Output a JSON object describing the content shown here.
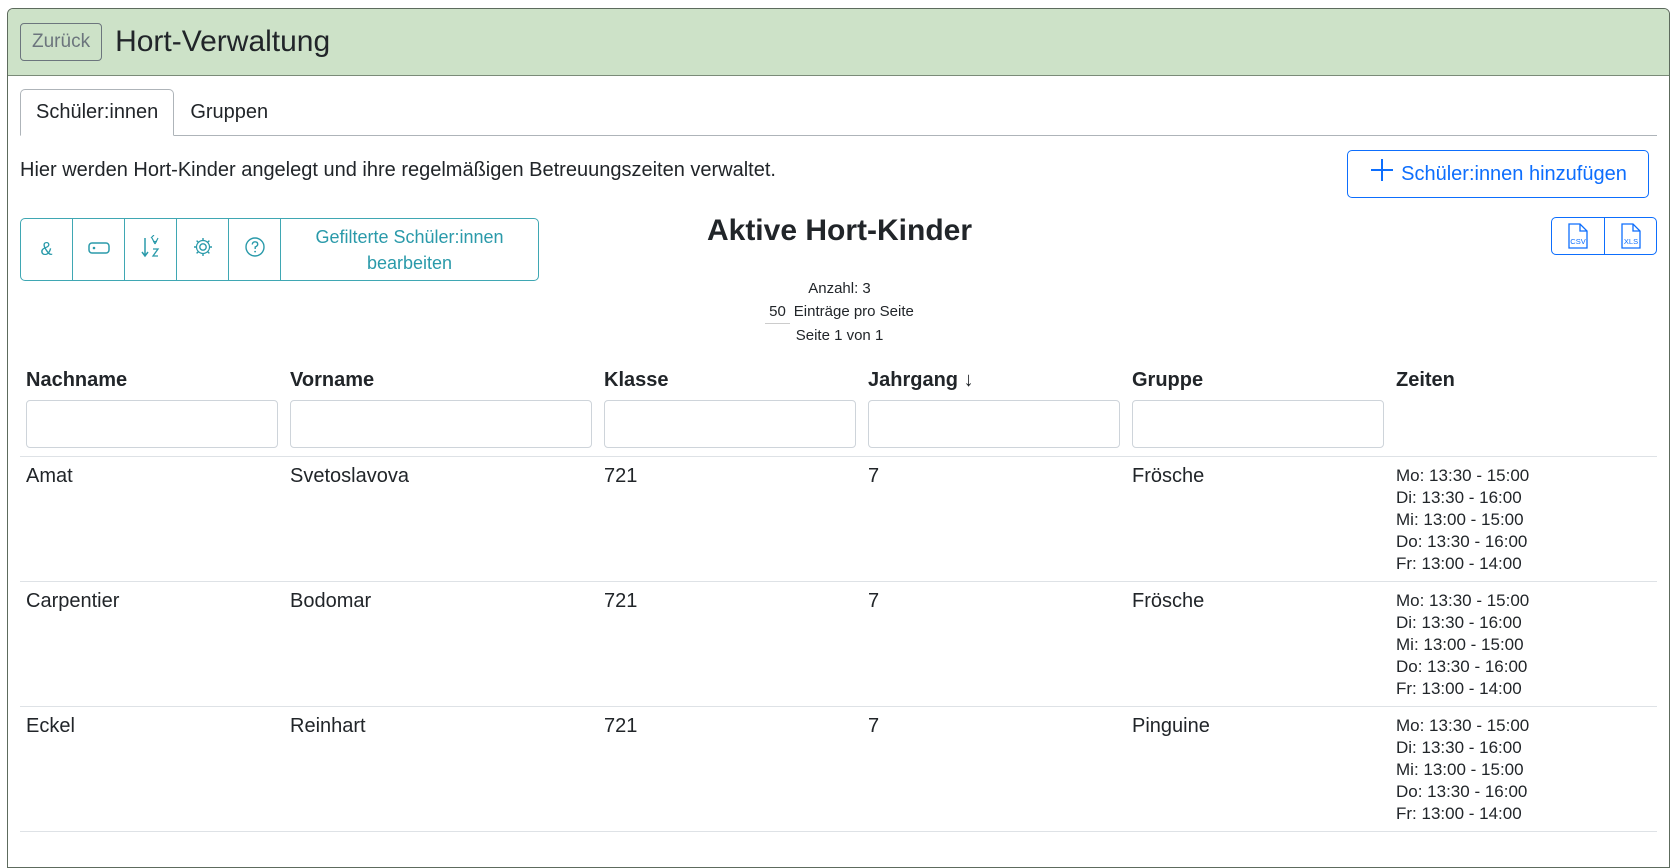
{
  "header": {
    "back_label": "Zurück",
    "title": "Hort-Verwaltung"
  },
  "tabs": [
    {
      "label": "Schüler:innen",
      "active": true
    },
    {
      "label": "Gruppen",
      "active": false
    }
  ],
  "intro_text": "Hier werden Hort-Kinder angelegt und ihre regelmäßigen Betreuungszeiten verwaltet.",
  "add_button": {
    "label": "Schüler:innen hinzufügen",
    "icon": "plus-icon"
  },
  "toolbar": {
    "ampersand_label": "&",
    "icons": [
      "tag-icon",
      "sort-icon",
      "gear-icon",
      "help-icon"
    ],
    "edit_filtered_label": "Gefilterte Schüler:innen bearbeiten"
  },
  "list": {
    "title": "Aktive Hort-Kinder",
    "count_label": "Anzahl: 3",
    "per_page_value": "50",
    "per_page_label": "Einträge pro Seite",
    "page_label": "Seite 1 von 1"
  },
  "export": {
    "csv_label": "CSV",
    "xls_label": "XLS"
  },
  "table": {
    "columns": [
      "Nachname",
      "Vorname",
      "Klasse",
      "Jahrgang ↓",
      "Gruppe",
      "Zeiten"
    ],
    "rows": [
      {
        "nachname": "Amat",
        "vorname": "Svetoslavova",
        "klasse": "721",
        "jahrgang": "7",
        "gruppe": "Frösche",
        "zeiten": [
          "Mo: 13:30 - 15:00",
          "Di: 13:30 - 16:00",
          "Mi: 13:00 - 15:00",
          "Do: 13:30 - 16:00",
          "Fr: 13:00 - 14:00"
        ]
      },
      {
        "nachname": "Carpentier",
        "vorname": "Bodomar",
        "klasse": "721",
        "jahrgang": "7",
        "gruppe": "Frösche",
        "zeiten": [
          "Mo: 13:30 - 15:00",
          "Di: 13:30 - 16:00",
          "Mi: 13:00 - 15:00",
          "Do: 13:30 - 16:00",
          "Fr: 13:00 - 14:00"
        ]
      },
      {
        "nachname": "Eckel",
        "vorname": "Reinhart",
        "klasse": "721",
        "jahrgang": "7",
        "gruppe": "Pinguine",
        "zeiten": [
          "Mo: 13:30 - 15:00",
          "Di: 13:30 - 16:00",
          "Mi: 13:00 - 15:00",
          "Do: 13:30 - 16:00",
          "Fr: 13:00 - 14:00"
        ]
      }
    ]
  },
  "colors": {
    "header_bg": "#cde2c8",
    "primary": "#0d6efd",
    "info": "#2a9aaa"
  }
}
